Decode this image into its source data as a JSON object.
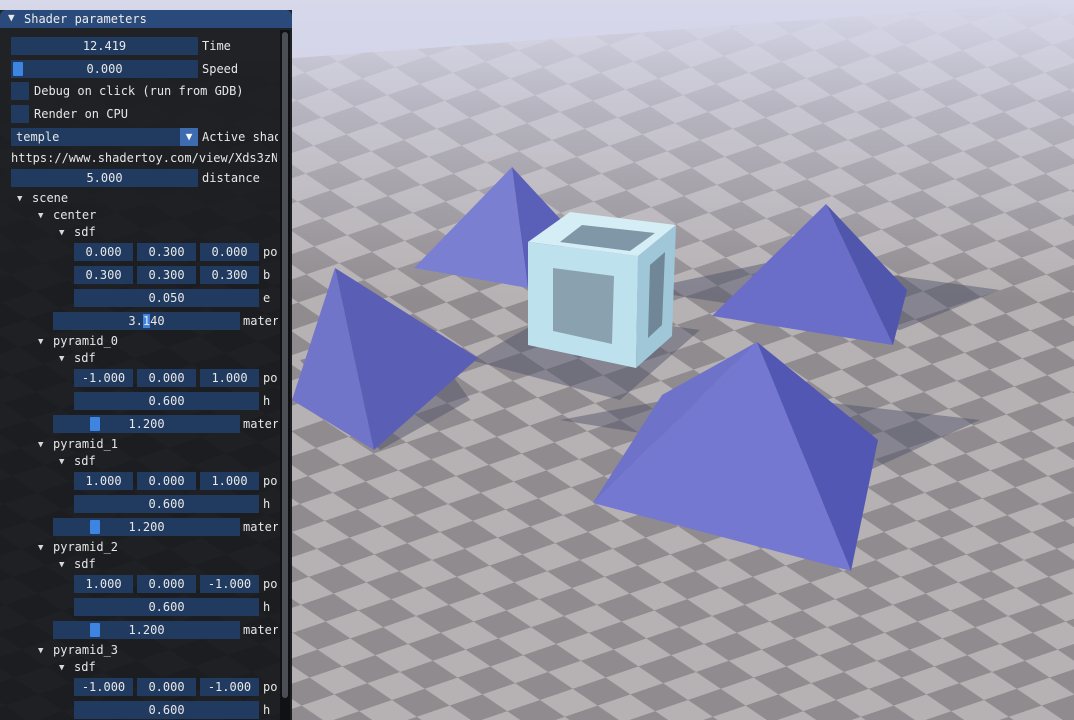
{
  "window": {
    "title": "Shader parameters"
  },
  "controls": {
    "time": {
      "value": "12.419",
      "label": "Time"
    },
    "speed": {
      "value": "0.000",
      "label": "Speed",
      "fraction": 0.0
    },
    "debug": {
      "label": "Debug on click (run from GDB)"
    },
    "render_cpu": {
      "label": "Render on CPU"
    },
    "shader": {
      "value": "temple",
      "label": "Active shad"
    },
    "url": "https://www.shadertoy.com/view/Xds3zN",
    "distance": {
      "value": "5.000",
      "label": "distance"
    }
  },
  "tree": {
    "scene": "scene",
    "center": {
      "name": "center",
      "sdf": "sdf",
      "pos": [
        "0.000",
        "0.300",
        "0.000"
      ],
      "pos_label": "po",
      "b": [
        "0.300",
        "0.300",
        "0.300"
      ],
      "b_label": "b",
      "e": "0.050",
      "e_label": "e",
      "material": {
        "value_a": "3.",
        "value_sel": "1",
        "value_b": "40",
        "label": "mater"
      }
    },
    "pyramids": [
      {
        "name": "pyramid_0",
        "sdf": "sdf",
        "pos": [
          "-1.000",
          "0.000",
          "1.000"
        ],
        "pos_label": "po",
        "h": "0.600",
        "h_label": "h",
        "material": {
          "value": "1.200",
          "label": "mater",
          "fraction": 0.2
        }
      },
      {
        "name": "pyramid_1",
        "sdf": "sdf",
        "pos": [
          "1.000",
          "0.000",
          "1.000"
        ],
        "pos_label": "po",
        "h": "0.600",
        "h_label": "h",
        "material": {
          "value": "1.200",
          "label": "mater",
          "fraction": 0.2
        }
      },
      {
        "name": "pyramid_2",
        "sdf": "sdf",
        "pos": [
          "1.000",
          "0.000",
          "-1.000"
        ],
        "pos_label": "po",
        "h": "0.600",
        "h_label": "h",
        "material": {
          "value": "1.200",
          "label": "mater",
          "fraction": 0.2
        }
      },
      {
        "name": "pyramid_3",
        "sdf": "sdf",
        "pos": [
          "-1.000",
          "0.000",
          "-1.000"
        ],
        "pos_label": "po",
        "h": "0.600",
        "h_label": "h"
      }
    ]
  },
  "colors": {
    "panel_bg": "#16181c",
    "title_bg": "#294a7a",
    "field_bg": "#203a60",
    "accent": "#3d85e0",
    "pyramid": "#6b6fc6",
    "cube": "#b7e0ee",
    "sky": "#eeeef8"
  },
  "icons": {
    "collapse": "triangle-down-icon",
    "combo": "dropdown-arrow-icon"
  }
}
